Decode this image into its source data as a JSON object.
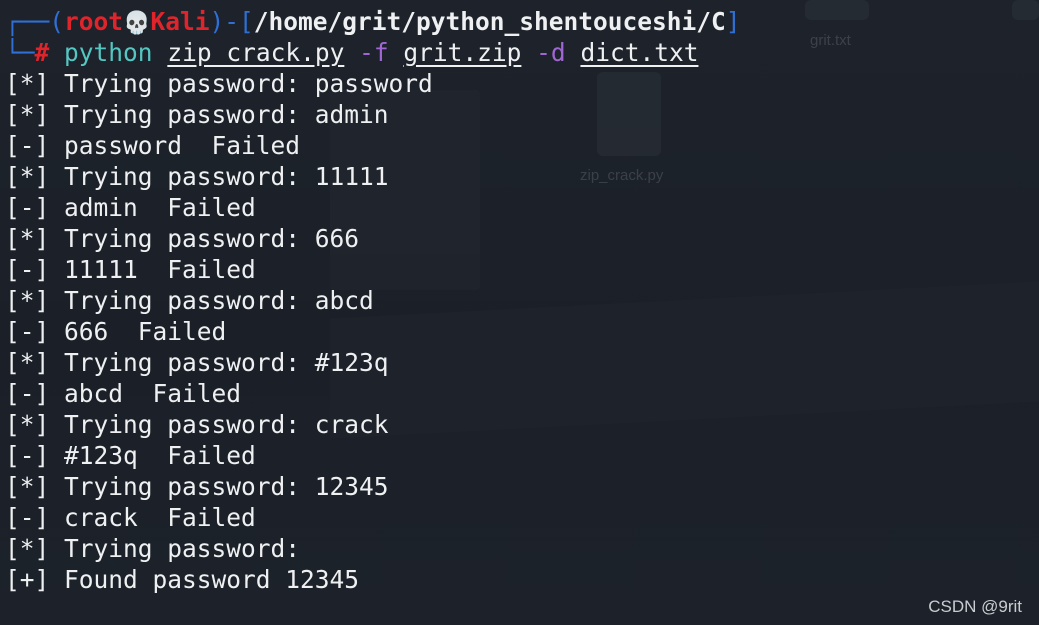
{
  "prompt": {
    "frame_top": "┌──(",
    "user": "root",
    "skull": "💀",
    "host": "Kali",
    "frame_mid": ")-[",
    "path": "/home/grit/python_shentouceshi/C",
    "frame_close": "]",
    "frame_bottom": "└─",
    "hash": "#"
  },
  "command": {
    "program": "python",
    "script": "zip_crack.py",
    "flag_file": "-f",
    "zip_file": "grit.zip",
    "flag_dict": "-d",
    "dict_file": "dict.txt"
  },
  "output_lines": [
    "[*] Trying password: password",
    "[*] Trying password: admin",
    "[-] password  Failed",
    "[*] Trying password: 11111",
    "[-] admin  Failed",
    "[*] Trying password: 666",
    "[-] 11111  Failed",
    "[*] Trying password: abcd",
    "[-] 666  Failed",
    "[*] Trying password: #123q",
    "[-] abcd  Failed",
    "[*] Trying password: crack",
    "[-] #123q  Failed",
    "[*] Trying password: 12345",
    "[-] crack  Failed",
    "[*] Trying password:",
    "[+] Found password 12345"
  ],
  "background": {
    "file_1": "grit.txt",
    "file_2": "zip_crack.py"
  },
  "watermark": "CSDN @9rit",
  "colors": {
    "background": "#1b1f26",
    "prompt_frame": "#2f6fd6",
    "prompt_user": "#e0242b",
    "command": "#55c7c2",
    "flag": "#a066d4",
    "text": "#eef0f2"
  }
}
